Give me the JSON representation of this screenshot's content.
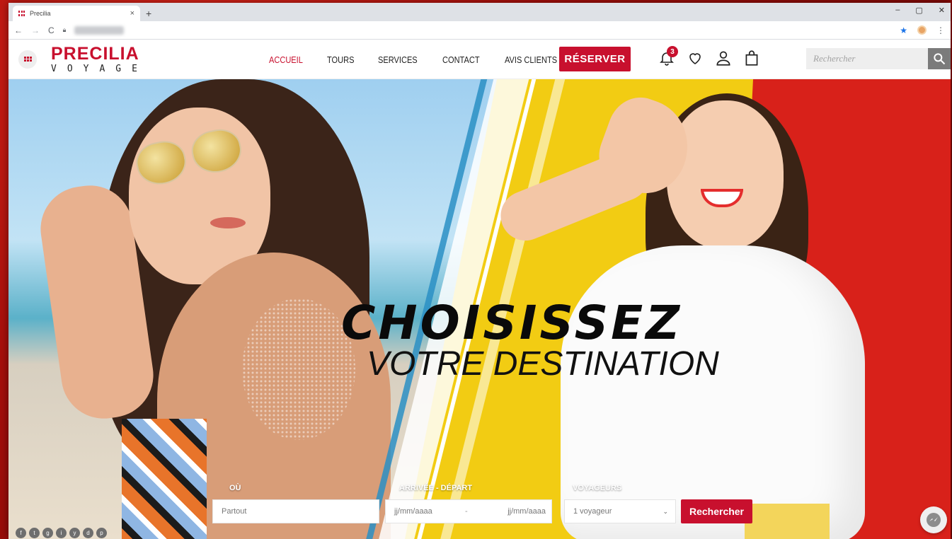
{
  "browser": {
    "tab_title": "Precilia",
    "tab_close": "×",
    "new_tab": "+",
    "window_controls": [
      "–",
      "▢",
      "✕"
    ]
  },
  "site": {
    "logo_brand": "PRECILIA",
    "logo_sub": "VOYAGE",
    "nav": [
      {
        "label": "ACCUEIL",
        "active": true
      },
      {
        "label": "TOURS"
      },
      {
        "label": "SERVICES"
      },
      {
        "label": "CONTACT"
      },
      {
        "label": "AVIS CLIENTS"
      }
    ],
    "reserve_label": "RÉSERVER",
    "notification_count": "3",
    "search_placeholder": "Rechercher",
    "icons": [
      "bell-icon",
      "heart-icon",
      "user-icon",
      "bag-icon",
      "search-icon"
    ]
  },
  "hero": {
    "headline_big": "CHOISISSEZ",
    "headline_small": "VOTRE DESTINATION"
  },
  "booking": {
    "where_label": "OÙ",
    "where_placeholder": "Partout",
    "dates_label": "ARRIVÉE - DÉPART",
    "date_start_placeholder": "jj/mm/aaaa",
    "date_separator": "-",
    "date_end_placeholder": "jj/mm/aaaa",
    "travelers_label": "VOYAGEURS",
    "travelers_value": "1 voyageur",
    "submit_label": "Rechercher"
  },
  "socials": [
    "f",
    "t",
    "g",
    "i",
    "y",
    "d",
    "p"
  ],
  "colors": {
    "brand_red": "#c8102e",
    "yellow": "#f2cc13",
    "red_panel": "#d8211a"
  }
}
